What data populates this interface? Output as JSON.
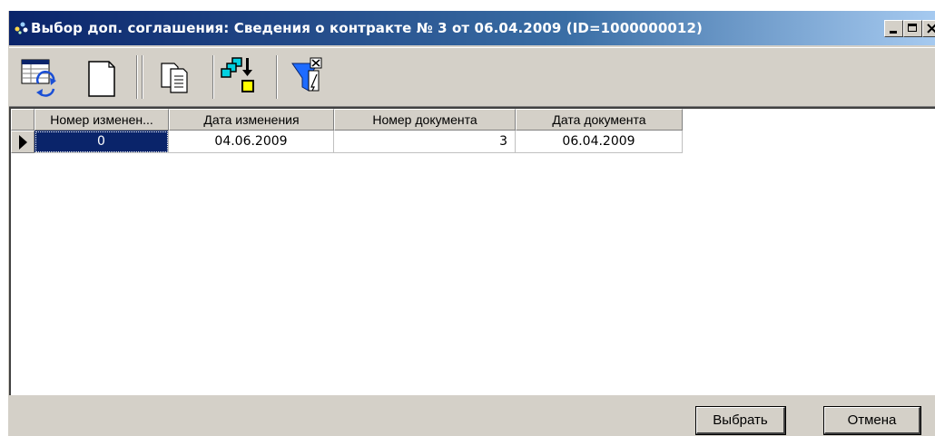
{
  "window": {
    "title": "Выбор доп. соглашения: Сведения о контракте № 3 от 06.04.2009 (ID=1000000012)",
    "colors": {
      "titlebar_start": "#0a246a",
      "titlebar_end": "#a6caf0",
      "face": "#d4d0c8",
      "selection": "#0a246a"
    }
  },
  "toolbar": {
    "buttons": [
      {
        "icon": "refresh-table-icon"
      },
      {
        "icon": "new-document-icon"
      },
      {
        "icon": "copy-icon"
      },
      {
        "icon": "move-down-icon"
      },
      {
        "icon": "clear-filter-icon"
      }
    ]
  },
  "grid": {
    "columns": [
      "Номер изменен...",
      "Дата изменения",
      "Номер документа",
      "Дата документа"
    ],
    "rows": [
      [
        "0",
        "04.06.2009",
        "3",
        "06.04.2009"
      ]
    ]
  },
  "footer": {
    "select_label": "Выбрать",
    "cancel_label": "Отмена"
  }
}
